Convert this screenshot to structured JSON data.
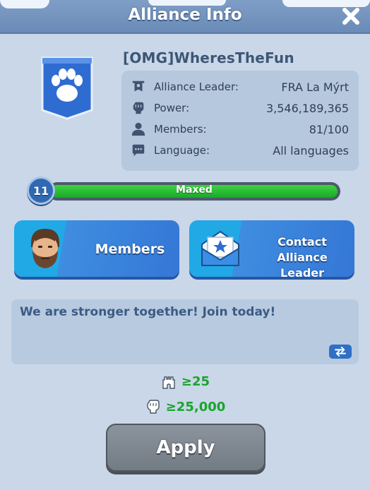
{
  "header": {
    "title": "Alliance Info",
    "close_icon": "close-icon"
  },
  "alliance": {
    "emblem_icon": "paw-banner-icon",
    "name": "[OMG]WheresTheFun",
    "info": [
      {
        "icon": "banner-icon",
        "label": "Alliance Leader:",
        "value": "FRA La Mýrt"
      },
      {
        "icon": "fist-icon",
        "label": "Power:",
        "value": "3,546,189,365"
      },
      {
        "icon": "person-icon",
        "label": "Members:",
        "value": "81/100"
      },
      {
        "icon": "chat-icon",
        "label": "Language:",
        "value": "All languages"
      }
    ],
    "level": "11",
    "level_status": "Maxed",
    "level_progress": 1.0,
    "description": "We are stronger together! Join today!"
  },
  "buttons": {
    "members_label": "Members",
    "contact_label_line1": "Contact Alliance",
    "contact_label_line2": "Leader",
    "apply_label": "Apply"
  },
  "requirements": [
    {
      "icon": "castle-icon",
      "value": "≥25"
    },
    {
      "icon": "fist-icon",
      "value": "≥25,000"
    }
  ],
  "colors": {
    "header": "#7391bd",
    "panel": "#c9d7e8",
    "accent_green": "#19a42b",
    "button_blue": "#3a84dc",
    "button_cyan": "#21a9e6",
    "apply_gray": "#7f8790"
  }
}
